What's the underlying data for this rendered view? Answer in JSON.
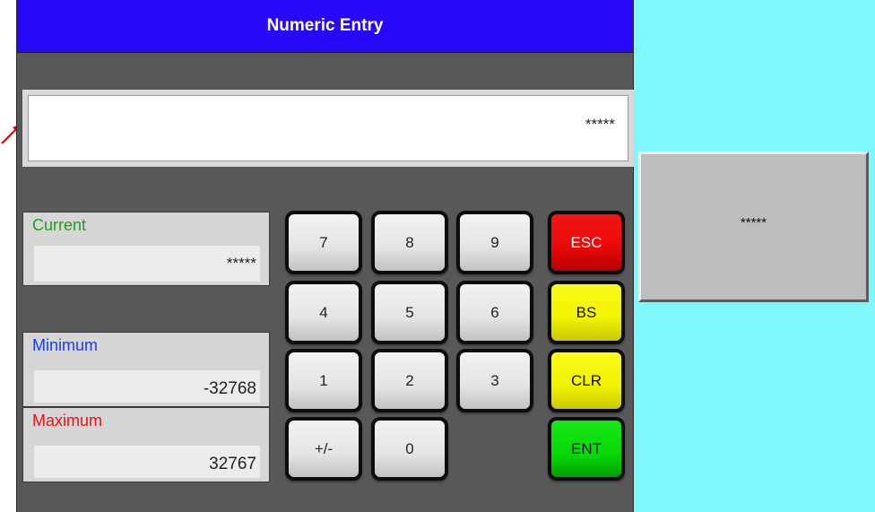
{
  "dialog": {
    "title": "Numeric Entry",
    "display_value": "*****"
  },
  "info": {
    "current": {
      "label": "Current",
      "value": "*****",
      "label_color": "#1ea01e"
    },
    "minimum": {
      "label": "Minimum",
      "value": "-32768",
      "label_color": "#1a3cf0"
    },
    "maximum": {
      "label": "Maximum",
      "value": "32767",
      "label_color": "#e81414"
    }
  },
  "keypad": {
    "k7": "7",
    "k8": "8",
    "k9": "9",
    "esc": "ESC",
    "k4": "4",
    "k5": "5",
    "k6": "6",
    "bs": "BS",
    "k1": "1",
    "k2": "2",
    "k3": "3",
    "clr": "CLR",
    "plus_minus": "+/-",
    "k0": "0",
    "ent": "ENT"
  },
  "side_button": {
    "label": "*****"
  },
  "colors": {
    "title_bar": "#2808f8",
    "dialog_bg": "#585858",
    "side_panel": "#7ef8fc",
    "esc": "#e80808",
    "bs_clr": "#f2f200",
    "ent": "#08d808",
    "arrow": "#d40000"
  }
}
